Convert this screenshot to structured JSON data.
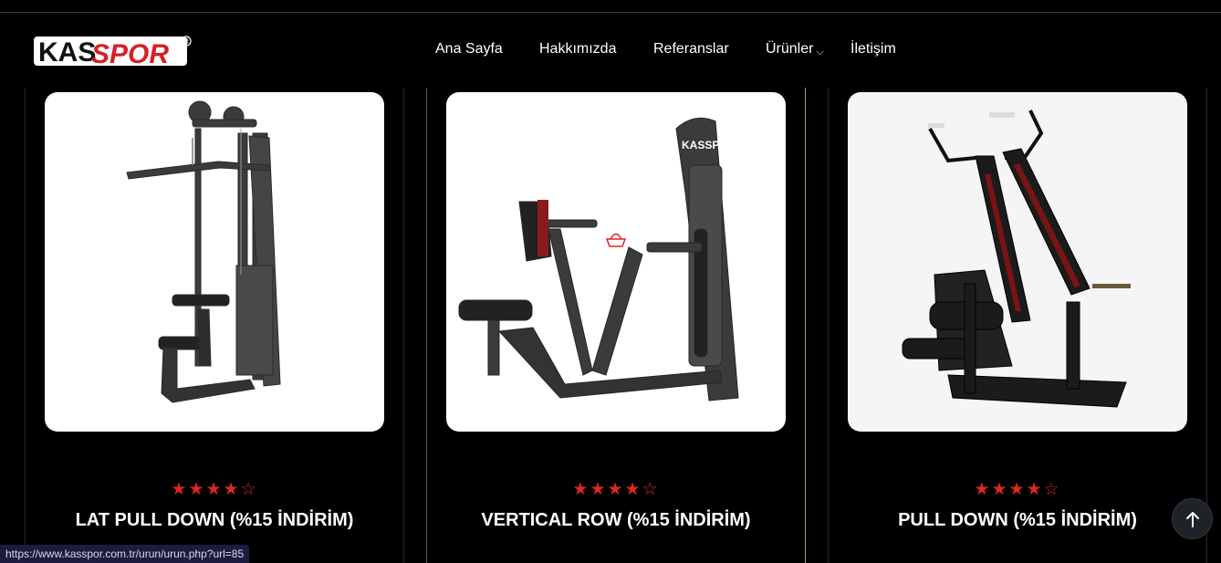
{
  "brand": {
    "logo_part1": "KAS",
    "logo_part2": "SPOR",
    "registered": "®"
  },
  "nav": {
    "items": [
      {
        "label": "Ana Sayfa"
      },
      {
        "label": "Hakkımızda"
      },
      {
        "label": "Referanslar"
      },
      {
        "label": "Ürünler"
      },
      {
        "label": "İletişim"
      }
    ],
    "dropdown_icon": "chevron-down-icon"
  },
  "products": [
    {
      "title": "LAT PULL DOWN (%15 İNDİRİM)",
      "rating": 4,
      "max_rating": 5,
      "stars_filled": "★★★★",
      "stars_empty": "☆"
    },
    {
      "title": "VERTICAL ROW (%15 İNDİRİM)",
      "rating": 4,
      "max_rating": 5,
      "stars_filled": "★★★★",
      "stars_empty": "☆",
      "machine_logo": "KASSPOR"
    },
    {
      "title": "PULL DOWN (%15 İNDİRİM)",
      "rating": 4,
      "max_rating": 5,
      "stars_filled": "★★★★",
      "stars_empty": "☆"
    }
  ],
  "status_bar": {
    "url": "https://www.kasspor.com.tr/urun/urun.php?url=85"
  },
  "icons": {
    "cart": "shopping-basket-icon",
    "scroll_top": "arrow-up-icon"
  },
  "colors": {
    "background": "#000000",
    "accent": "#e02424",
    "card": "#ffffff",
    "machine": "#3b3b3b"
  }
}
